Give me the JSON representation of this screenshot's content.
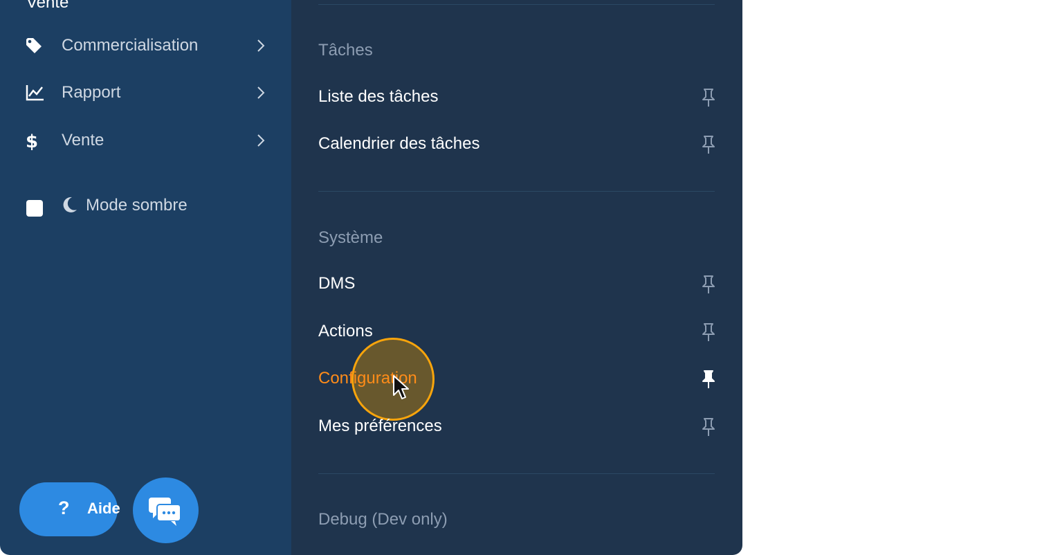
{
  "sidebar": {
    "cut_title": "Vente",
    "items": [
      {
        "label": "Commercialisation",
        "icon": "tag-icon"
      },
      {
        "label": "Rapport",
        "icon": "line-chart-icon"
      },
      {
        "label": "Vente",
        "icon": "dollar-icon"
      }
    ],
    "dark_mode": {
      "label": "Mode sombre",
      "checked": false,
      "icon": "moon-icon"
    },
    "help_button": {
      "label": "Aide",
      "icon_glyph": "?"
    },
    "chat_button": {
      "icon": "chat-bubbles-icon"
    }
  },
  "submenu": {
    "sections": [
      {
        "title": "Tâches",
        "items": [
          {
            "label": "Liste des tâches",
            "pinned": false
          },
          {
            "label": "Calendrier des tâches",
            "pinned": false
          }
        ]
      },
      {
        "title": "Système",
        "items": [
          {
            "label": "DMS",
            "pinned": false
          },
          {
            "label": "Actions",
            "pinned": false
          },
          {
            "label": "Configuration",
            "pinned": true,
            "active": true
          },
          {
            "label": "Mes préférences",
            "pinned": false
          }
        ]
      },
      {
        "title": "Debug (Dev only)",
        "items": []
      }
    ]
  },
  "colors": {
    "sidebar_bg": "#1c3f63",
    "submenu_bg": "#1f344d",
    "accent": "#ff8c19",
    "button_blue": "#2d8ae2",
    "cursor_ring": "#f7a40c"
  }
}
